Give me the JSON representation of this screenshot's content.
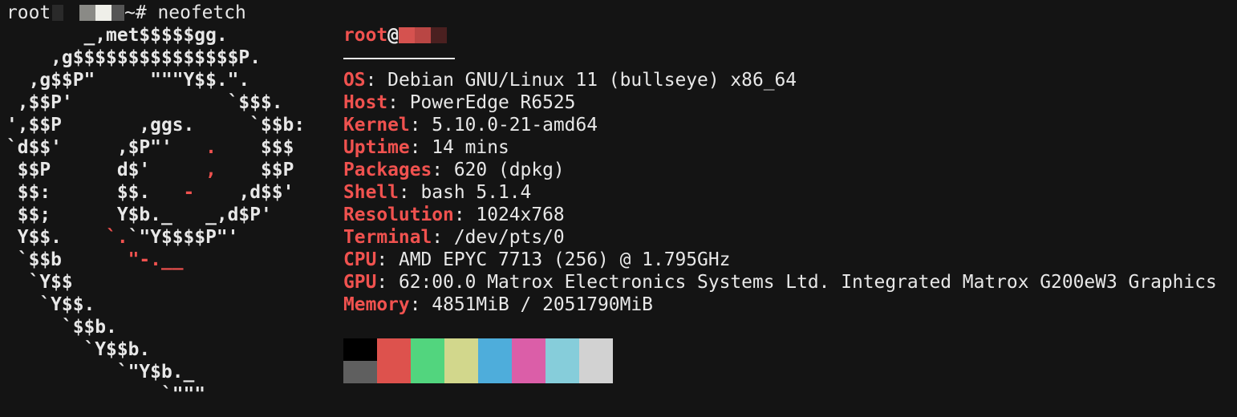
{
  "prompt": {
    "user": "root",
    "path_symbol": "~#",
    "command": "neofetch"
  },
  "logo_lines": [
    [
      [
        "       _,met$$$$$gg.",
        false
      ]
    ],
    [
      [
        "    ,g$$$$$$$$$$$$$$$P.",
        false
      ]
    ],
    [
      [
        "  ,g$$P\"     \"\"\"Y$$.\".",
        false
      ]
    ],
    [
      [
        " ,$$P'              `$$$.",
        false
      ]
    ],
    [
      [
        "',$$P       ,ggs.     `$$b:",
        false
      ]
    ],
    [
      [
        "`d$$'     ,$P\"'   ",
        false
      ],
      [
        ".",
        true
      ],
      [
        "    $$$",
        false
      ]
    ],
    [
      [
        " $$P      d$'     ",
        false
      ],
      [
        ",",
        true
      ],
      [
        "    $$P",
        false
      ]
    ],
    [
      [
        " $$:      $$.   ",
        false
      ],
      [
        "-",
        true
      ],
      [
        "    ,d$$'",
        false
      ]
    ],
    [
      [
        " $$;      Y$b._   _,d$P'",
        false
      ]
    ],
    [
      [
        " Y$$.    ",
        false
      ],
      [
        "`.",
        true
      ],
      [
        "`\"Y$$$$P\"'",
        false
      ]
    ],
    [
      [
        " `$$b      ",
        false
      ],
      [
        "\"-.__",
        true
      ]
    ],
    [
      [
        "  `Y$$",
        false
      ]
    ],
    [
      [
        "   `Y$$.",
        false
      ]
    ],
    [
      [
        "     `$$b.",
        false
      ]
    ],
    [
      [
        "       `Y$$b.",
        false
      ]
    ],
    [
      [
        "          `\"Y$b._",
        false
      ]
    ],
    [
      [
        "              `\"\"\"",
        false
      ]
    ]
  ],
  "info": {
    "title_user": "root",
    "title_at": "@",
    "fields": [
      {
        "label": "OS",
        "value": "Debian GNU/Linux 11 (bullseye) x86_64"
      },
      {
        "label": "Host",
        "value": "PowerEdge R6525"
      },
      {
        "label": "Kernel",
        "value": "5.10.0-21-amd64"
      },
      {
        "label": "Uptime",
        "value": "14 mins"
      },
      {
        "label": "Packages",
        "value": "620 (dpkg)"
      },
      {
        "label": "Shell",
        "value": "bash 5.1.4"
      },
      {
        "label": "Resolution",
        "value": "1024x768"
      },
      {
        "label": "Terminal",
        "value": "/dev/pts/0"
      },
      {
        "label": "CPU",
        "value": "AMD EPYC 7713 (256) @ 1.795GHz"
      },
      {
        "label": "GPU",
        "value": "62:00.0 Matrox Electronics Systems Ltd. Integrated Matrox G200eW3 Graphics"
      },
      {
        "label": "Memory",
        "value": "4851MiB / 2051790MiB"
      }
    ]
  },
  "colors": {
    "background": "#141414",
    "accent_red": "#f0524f",
    "palette_normal": [
      "#000000",
      "#dd524d",
      "#52d57e",
      "#d2d78c",
      "#4eaddb",
      "#db5ea8",
      "#86cdda",
      "#d2d2d2"
    ],
    "palette_bright": [
      "#5f5f5f",
      "#dd524d",
      "#52d57e",
      "#d2d78c",
      "#4eaddb",
      "#db5ea8",
      "#86cdda",
      "#d2d2d2"
    ]
  }
}
